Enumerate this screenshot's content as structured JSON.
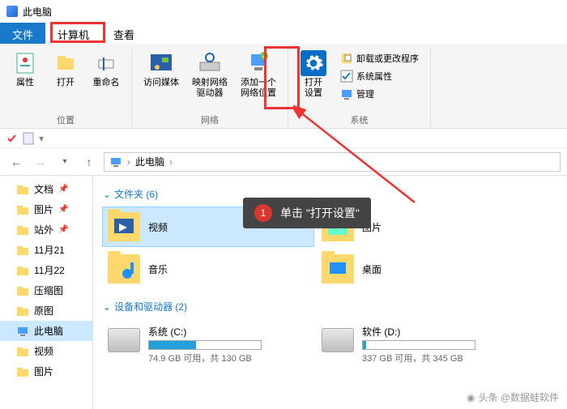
{
  "window": {
    "title": "此电脑"
  },
  "tabs": {
    "file": "文件",
    "computer": "计算机",
    "view": "查看"
  },
  "ribbon": {
    "location": {
      "props": "属性",
      "open": "打开",
      "rename": "重命名",
      "group": "位置"
    },
    "network": {
      "media": "访问媒体",
      "mapdrive": "映射网络\n驱动器",
      "addloc": "添加一个\n网络位置",
      "group": "网络"
    },
    "system": {
      "opensettings": "打开\n设置",
      "uninstall": "卸载或更改程序",
      "sysprops": "系统属性",
      "manage": "管理",
      "group": "系统"
    }
  },
  "nav": {
    "crumb_root": "此电脑",
    "sep": "›"
  },
  "sidebar": {
    "items": [
      {
        "label": "文档",
        "pin": true
      },
      {
        "label": "图片",
        "pin": true
      },
      {
        "label": "站外",
        "pin": true
      },
      {
        "label": "11月21"
      },
      {
        "label": "11月22"
      },
      {
        "label": "压缩图"
      },
      {
        "label": "原图"
      },
      {
        "label": "此电脑",
        "selected": true
      },
      {
        "label": "视频"
      },
      {
        "label": "图片"
      }
    ]
  },
  "main": {
    "folders_header": "文件夹 (6)",
    "folders": [
      {
        "label": "视频"
      },
      {
        "label": "图片"
      },
      {
        "label": "音乐"
      },
      {
        "label": "桌面"
      }
    ],
    "drives_header": "设备和驱动器 (2)",
    "drives": [
      {
        "label": "系统 (C:)",
        "sub": "74.9 GB 可用，共 130 GB",
        "fill": 42
      },
      {
        "label": "软件 (D:)",
        "sub": "337 GB 可用，共 345 GB",
        "fill": 3
      }
    ]
  },
  "callout": {
    "num": "1",
    "text": "单击 \"打开设置\""
  },
  "watermark": "头条 @数据蛙软件"
}
